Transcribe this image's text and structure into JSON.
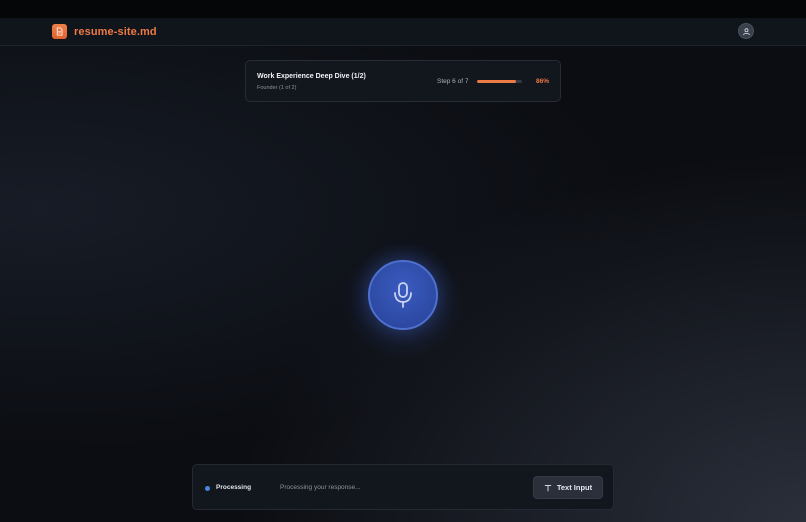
{
  "app": {
    "name": "resume-site.md",
    "brand_color": "#ee7a44"
  },
  "progress": {
    "title": "Work Experience Deep Dive (1/2)",
    "subtitle": "Founder (1 of 2)",
    "step_text": "Step 6 of 7",
    "percent_text": "86%",
    "percent_value": 86
  },
  "mic": {
    "icon": "microphone-icon",
    "color": "#2d49a3"
  },
  "status": {
    "label": "Processing",
    "message": "Processing your response...",
    "dot_color": "#4a86e0"
  },
  "actions": {
    "text_input_label": "Text Input",
    "text_input_icon": "text-t-icon"
  },
  "user": {
    "avatar_icon": "user-icon"
  }
}
